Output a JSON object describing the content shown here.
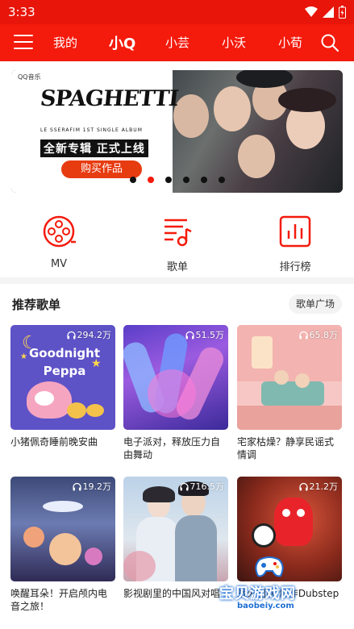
{
  "status_bar": {
    "time": "3:33"
  },
  "nav": {
    "tabs": [
      "我的",
      "小Q",
      "小芸",
      "小沃",
      "小荀"
    ],
    "active_tab": "小Q"
  },
  "banner": {
    "brand": "QQ音乐",
    "album_title": "SPAGHETTI",
    "album_sub": "LE SSERAFIM    1ST SINGLE ALBUM",
    "slogan": "全新专辑 正式上线",
    "button": "购买作品",
    "dot_count": 6,
    "active_dot": 1
  },
  "quick_entries": [
    {
      "label": "MV",
      "icon": "film-reel-icon"
    },
    {
      "label": "歌单",
      "icon": "playlist-icon"
    },
    {
      "label": "排行榜",
      "icon": "chart-icon"
    }
  ],
  "section": {
    "title": "推荐歌单",
    "more": "歌单广场"
  },
  "playlists": [
    {
      "title": "小猪佩奇睡前晚安曲",
      "plays": "294.2万",
      "cover_text": "Goodnight Peppa"
    },
    {
      "title": "电子派对，释放压力自由舞动",
      "plays": "51.5万"
    },
    {
      "title": "宅家枯燥？静享民谣式情调",
      "plays": "65.8万"
    },
    {
      "title": "唤醒耳朵！开启颅内电音之旅！",
      "plays": "19.2万"
    },
    {
      "title": "影视剧里的中国风对唱",
      "plays": "716.5万"
    },
    {
      "title": "战火团队 燃炸Dubstep",
      "plays": "21.2万"
    }
  ],
  "watermark": {
    "text": "宝贝游戏网",
    "url": "baobeiy.com"
  },
  "colors": {
    "accent": "#f41a0c",
    "status_bar": "#e8150a"
  }
}
